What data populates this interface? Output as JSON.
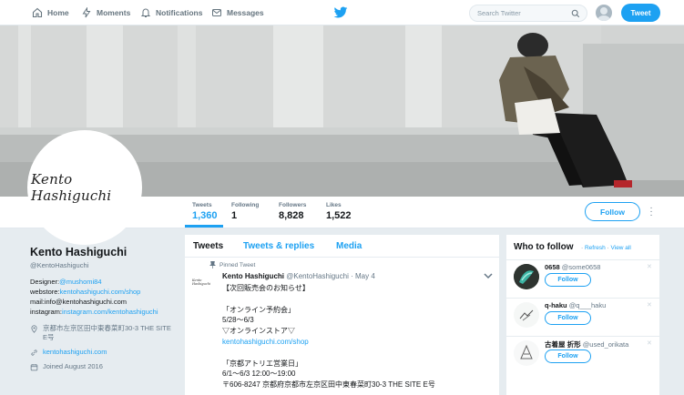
{
  "nav": {
    "home": "Home",
    "moments": "Moments",
    "notifications": "Notifications",
    "messages": "Messages",
    "search_placeholder": "Search Twitter",
    "tweet_button": "Tweet"
  },
  "profile": {
    "avatar_text": "Kento Hashiguchi",
    "name": "Kento Hashiguchi",
    "handle": "@KentoHashiguchi",
    "bio": {
      "designer_prefix": "Designer:",
      "designer_link": "@mushomi84",
      "webstore_prefix": "webstore:",
      "webstore_link": "kentohashiguchi.com/shop",
      "mail_prefix": "mail:",
      "mail_value": "info@kentohashiguchi.com",
      "instagram_prefix": "instagram:",
      "instagram_link": "instagram.com/kentohashiguchi"
    },
    "location": "京都市左京区田中東春菜町30-3 THE SITE E号",
    "website": "kentohashiguchi.com",
    "joined": "Joined August 2016"
  },
  "stats": [
    {
      "label": "Tweets",
      "value": "1,360"
    },
    {
      "label": "Following",
      "value": "1"
    },
    {
      "label": "Followers",
      "value": "8,828"
    },
    {
      "label": "Likes",
      "value": "1,522"
    }
  ],
  "follow_button": "Follow",
  "timeline": {
    "tabs": [
      "Tweets",
      "Tweets & replies",
      "Media"
    ],
    "pinned_label": "Pinned Tweet",
    "tweet": {
      "avatar_text": "Kento Hashiguchi",
      "name": "Kento Hashiguchi",
      "handle": "@KentoHashiguchi",
      "date": "May 4",
      "lines": [
        "【次回販売会のお知らせ】",
        "",
        "「オンライン予約会」",
        "5/28〜6/3",
        "▽オンラインストア▽",
        "kentohashiguchi.com/shop",
        "",
        "「京都アトリエ営業日」",
        "6/1〜6/3 12:00〜19:00",
        "〒606-8247 京都府京都市左京区田中東春菜町30-3 THE SITE E号"
      ]
    }
  },
  "who_to_follow": {
    "title": "Who to follow",
    "refresh": "Refresh",
    "view_all": "View all",
    "follow_label": "Follow",
    "accounts": [
      {
        "name": "0658",
        "handle": "@some0658"
      },
      {
        "name": "q-haku",
        "handle": "@q___haku"
      },
      {
        "name": "古着屋 折形",
        "handle": "@used_orikata"
      }
    ]
  },
  "colors": {
    "accent": "#1da1f2",
    "background": "#e6ecf0",
    "text": "#14171a",
    "secondary": "#657786"
  }
}
